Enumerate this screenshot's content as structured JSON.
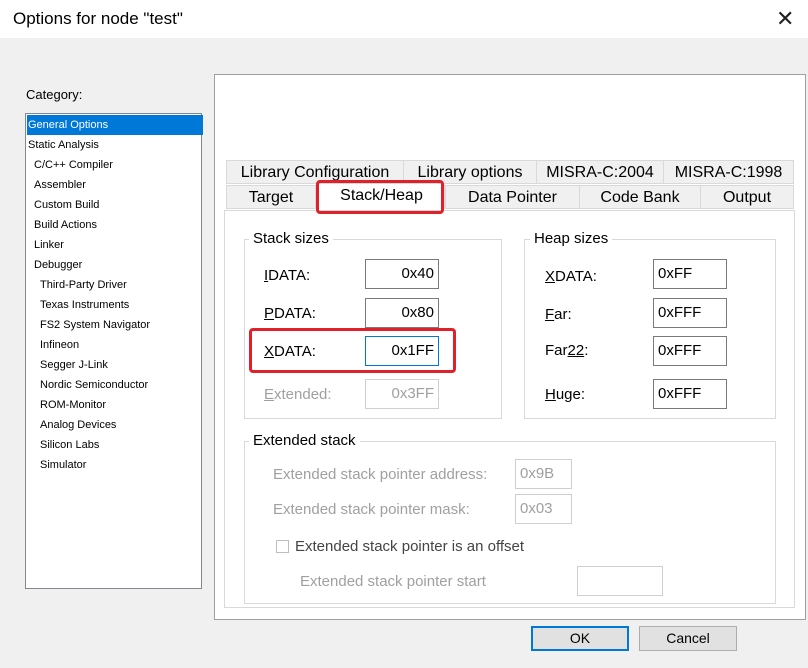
{
  "window": {
    "title": "Options for node \"test\"",
    "close_glyph": "✕"
  },
  "category": {
    "label": "Category:",
    "items": [
      "General Options",
      "Static Analysis",
      "C/C++ Compiler",
      "Assembler",
      "Custom Build",
      "Build Actions",
      "Linker",
      "Debugger",
      "Third-Party Driver",
      "Texas Instruments",
      "FS2 System Navigator",
      "Infineon",
      "Segger J-Link",
      "Nordic Semiconductor",
      "ROM-Monitor",
      "Analog Devices",
      "Silicon Labs",
      "Simulator"
    ],
    "selected": "General Options"
  },
  "tabs": {
    "row1": [
      "Library Configuration",
      "Library options",
      "MISRA-C:2004",
      "MISRA-C:1998"
    ],
    "row2": [
      "Target",
      "Stack/Heap",
      "Data Pointer",
      "Code Bank",
      "Output"
    ],
    "active": "Stack/Heap"
  },
  "stack_sizes": {
    "title": "Stack sizes",
    "idata": {
      "label_key": "I",
      "label_rest": "DATA:",
      "value": "0x40"
    },
    "pdata": {
      "label_key": "P",
      "label_rest": "DATA:",
      "value": "0x80"
    },
    "xdata": {
      "label_key": "X",
      "label_rest": "DATA:",
      "value": "0x1FF"
    },
    "extended": {
      "label_key": "E",
      "label_rest": "xtended:",
      "value": "0x3FF"
    }
  },
  "heap_sizes": {
    "title": "Heap sizes",
    "xdata": {
      "label_pre": "",
      "label_key": "X",
      "label_rest": "DATA:",
      "value": "0xFF"
    },
    "far": {
      "label_pre": "",
      "label_key": "F",
      "label_rest": "ar:",
      "value": "0xFFF"
    },
    "far22": {
      "label_pre": "Far",
      "label_key": "22",
      "label_rest": ":",
      "value": "0xFFF"
    },
    "huge": {
      "label_pre": "",
      "label_key": "H",
      "label_rest": "uge:",
      "value": "0xFFF"
    }
  },
  "extended_stack": {
    "title": "Extended stack",
    "address_label": "Extended stack pointer address:",
    "address_value": "0x9B",
    "mask_label": "Extended stack pointer mask:",
    "mask_value": "0x03",
    "offset_label": "Extended stack pointer is an offset",
    "offset_checked": false,
    "start_label": "Extended stack pointer start",
    "start_value": ""
  },
  "buttons": {
    "ok": "OK",
    "cancel": "Cancel"
  },
  "colors": {
    "accent": "#0078d7",
    "highlight": "#e0202a"
  }
}
